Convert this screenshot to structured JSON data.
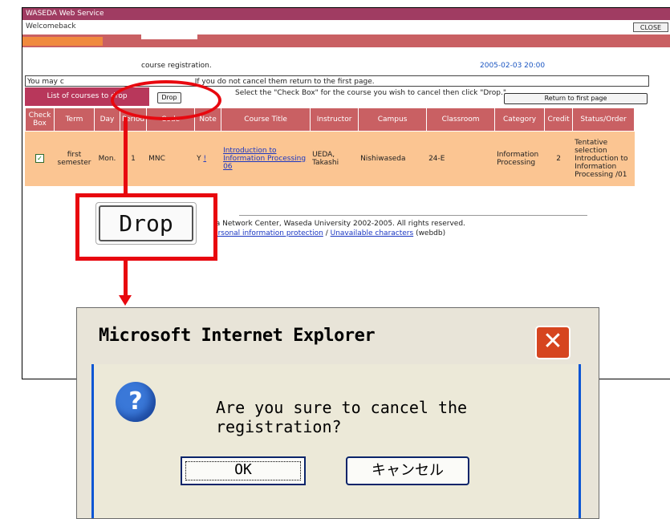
{
  "window": {
    "title": "WASEDA Web Service",
    "welcome": "Welcomeback",
    "close_label": "CLOSE"
  },
  "registration": {
    "title": "course registration.",
    "datetime": "2005-02-03 20:00",
    "notice_left": "You may c",
    "notice_right": ". If you do not cancel them return to the first page.",
    "list_label": "List of courses to drop",
    "drop_label": "Drop",
    "instruction": "Select the \"Check Box\" for the course you wish to cancel then click \"Drop.\"",
    "return_label": "Return to first page"
  },
  "table": {
    "headers": [
      "Check Box",
      "Term",
      "Day",
      "Period",
      "Code",
      "Note",
      "Course Title",
      "Instructor",
      "Campus",
      "Classroom",
      "Category",
      "Credit",
      "Status/Order"
    ],
    "row": {
      "term": "first semester",
      "day": "Mon.",
      "period": "1",
      "code": "MNC",
      "note": "Y",
      "note_link": "!",
      "course_title": "Introduction to Information Processing 06",
      "instructor": "UEDA, Takashi",
      "campus": "Nishiwaseda",
      "classroom": "24-E",
      "category": "Information Processing",
      "credit": "2",
      "status": "Tentative selection Introduction to Information Processing /01",
      "checked": true
    }
  },
  "footer": {
    "copyright": "edia Network Center, Waseda University 2002-2005. All rights reserved.",
    "link_sep": "/",
    "privacy_link": "Personal information protection",
    "unavailable_link": "Unavailable characters",
    "webdb": "(webdb)"
  },
  "callout": {
    "drop_label": "Drop"
  },
  "dialog": {
    "title": "Microsoft Internet Explorer",
    "message": "Are you sure to cancel the registration?",
    "ok_label": "OK",
    "cancel_label": "キャンセル",
    "icon": "question-icon"
  },
  "colors": {
    "header_bar": "#a03c62",
    "table_header": "#c96063",
    "table_row": "#fbc592",
    "annotation_red": "#e8080f"
  }
}
